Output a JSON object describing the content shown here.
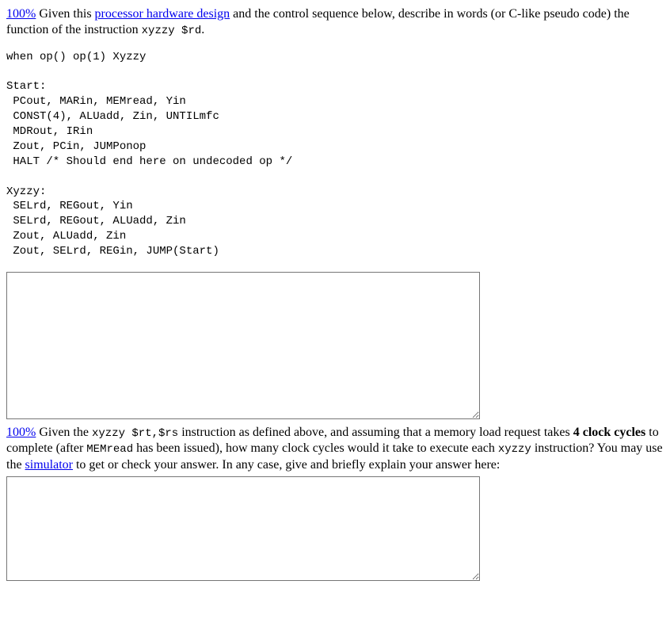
{
  "q1": {
    "percent_link": "100%",
    "text_before_link": " Given this ",
    "hardware_link": "processor hardware design",
    "text_after_link": " and the control sequence below, describe in words (or C-like pseudo code) the function of the instruction ",
    "instr": "xyzzy $rd",
    "period": "."
  },
  "code_block": "when op() op(1) Xyzzy\n\nStart:\n PCout, MARin, MEMread, Yin\n CONST(4), ALUadd, Zin, UNTILmfc\n MDRout, IRin\n Zout, PCin, JUMPonop\n HALT /* Should end here on undecoded op */\n\nXyzzy:\n SELrd, REGout, Yin\n SELrd, REGout, ALUadd, Zin\n Zout, ALUadd, Zin\n Zout, SELrd, REGin, JUMP(Start)",
  "q2": {
    "percent_link": "100%",
    "text1": " Given the ",
    "instr": "xyzzy $rt,$rs",
    "text2": " instruction as defined above, and assuming that a memory load request takes ",
    "bold": "4 clock cycles",
    "text3": " to complete (after ",
    "memread": "MEMread",
    "text4": " has been issued), how many clock cycles would it take to execute each ",
    "instr2": "xyzzy",
    "text5": " instruction? You may use the ",
    "sim_link": "simulator",
    "text6": " to get or check your answer. In any case, give and briefly explain your answer here:"
  },
  "answer1": "",
  "answer2": ""
}
